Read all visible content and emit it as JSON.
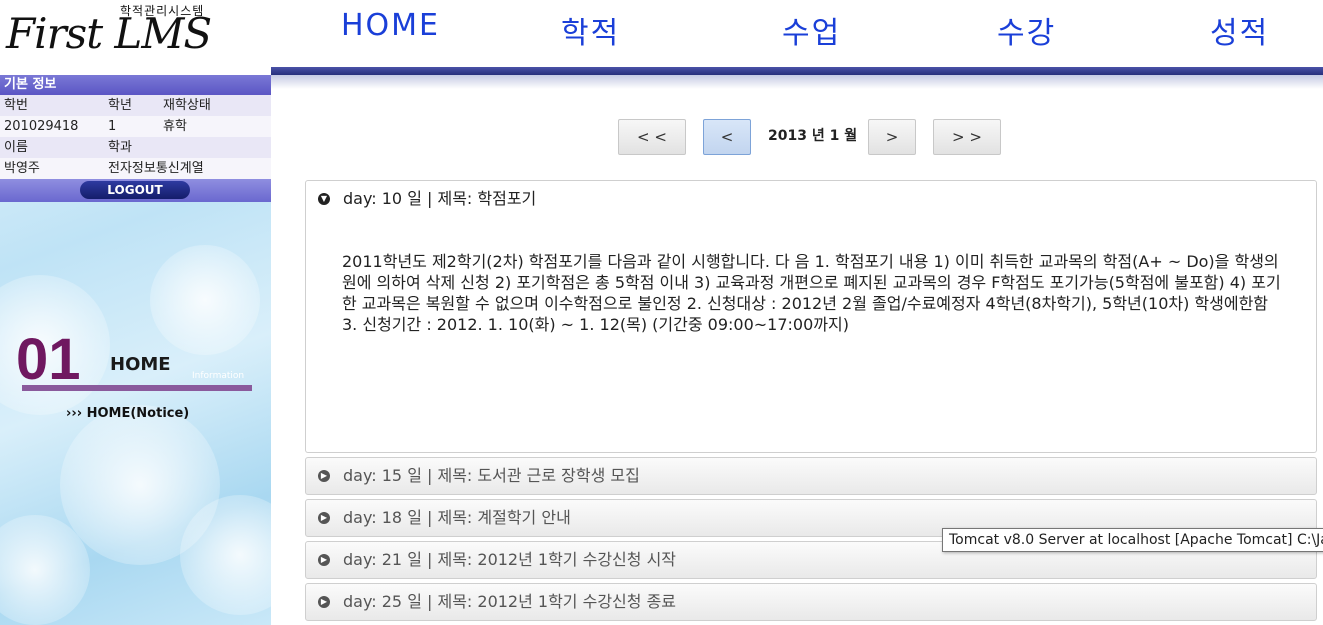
{
  "logo": {
    "script_text": "First LMS",
    "subtitle": "학적관리시스템"
  },
  "nav": {
    "items": [
      "HOME",
      "학적",
      "수업",
      "수강",
      "성적"
    ]
  },
  "info": {
    "title": "기본 정보",
    "headers1": [
      "학번",
      "학년",
      "재학상태"
    ],
    "values1": [
      "201029418",
      "1",
      "휴학"
    ],
    "headers2": [
      "이름",
      "학과"
    ],
    "values2": [
      "박영주",
      "전자정보통신계열"
    ],
    "logout": "LOGOUT"
  },
  "section": {
    "number": "01",
    "name": "HOME",
    "watermark": "Information",
    "sub_link": "››› HOME(Notice)"
  },
  "pager": {
    "first": "< <",
    "prev": "<",
    "period": "2013 년 1 월",
    "next": ">",
    "last": "> >"
  },
  "notices": [
    {
      "text": "day: 10 일 | 제목: 학점포기",
      "open": true
    },
    {
      "text": "day: 15 일 | 제목: 도서관 근로 장학생 모집",
      "open": false
    },
    {
      "text": "day: 18 일 | 제목: 계절학기 안내",
      "open": false
    },
    {
      "text": "day: 21 일 | 제목: 2012년 1학기 수강신청 시작",
      "open": false
    },
    {
      "text": "day: 25 일 | 제목: 2012년 1학기 수강신청 종료",
      "open": false
    }
  ],
  "notice_body": "2011학년도 제2학기(2차) 학점포기를 다음과 같이 시행합니다. 다 음 1. 학점포기 내용 1) 이미 취득한 교과목의 학점(A+ ~ Do)을 학생의 원에 의하여 삭제 신청 2) 포기학점은 총 5학점 이내 3) 교육과정 개편으로 폐지된 교과목의 경우 F학점도 포기가능(5학점에 불포함) 4) 포기한 교과목은 복원할 수 없으며 이수학점으로 불인정 2. 신청대상 : 2012년 2월 졸업/수료예정자 4학년(8차학기), 5학년(10차) 학생에한함 3. 신청기간 : 2012. 1. 10(화) ~ 1. 12(목) (기간중 09:00~17:00까지)",
  "tooltip": "Tomcat v8.0 Server at localhost [Apache Tomcat] C:\\Jav",
  "colors": {
    "nav_text": "#1a3fd8",
    "section_number": "#6f1860",
    "nav_bar": "#27307c"
  }
}
